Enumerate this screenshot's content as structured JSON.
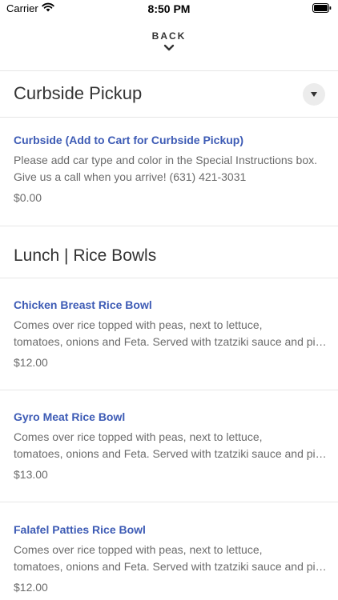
{
  "status_bar": {
    "carrier": "Carrier",
    "time": "8:50 PM"
  },
  "back": {
    "label": "BACK"
  },
  "sections": [
    {
      "title": "Curbside Pickup",
      "items": [
        {
          "name": "Curbside (Add to Cart for Curbside Pickup)",
          "description": "Please add car type and color in the Special Instructions box. Give us a call when you arrive! (631) 421-3031",
          "price": "$0.00"
        }
      ]
    },
    {
      "title": "Lunch | Rice Bowls",
      "items": [
        {
          "name": "Chicken Breast Rice Bowl",
          "description_line1": "Comes over rice topped with peas, next to lettuce,",
          "description_line2": "tomatoes, onions and Feta. Served with tzatziki sauce and pita bread",
          "price": "$12.00"
        },
        {
          "name": "Gyro Meat Rice Bowl",
          "description_line1": "Comes over rice topped with peas, next to lettuce,",
          "description_line2": "tomatoes, onions and Feta. Served with tzatziki sauce and pita bread",
          "price": "$13.00"
        },
        {
          "name": "Falafel Patties Rice Bowl",
          "description_line1": "Comes over rice topped with peas, next to lettuce,",
          "description_line2": "tomatoes, onions and Feta. Served with tzatziki sauce and pita bread",
          "price": "$12.00"
        }
      ]
    }
  ],
  "colors": {
    "link": "#3d5bb5",
    "muted": "#6b6b6b",
    "divider": "#e6e6e6"
  },
  "icons": [
    "wifi-icon",
    "battery-icon",
    "chevron-down-icon",
    "caret-down-icon"
  ]
}
